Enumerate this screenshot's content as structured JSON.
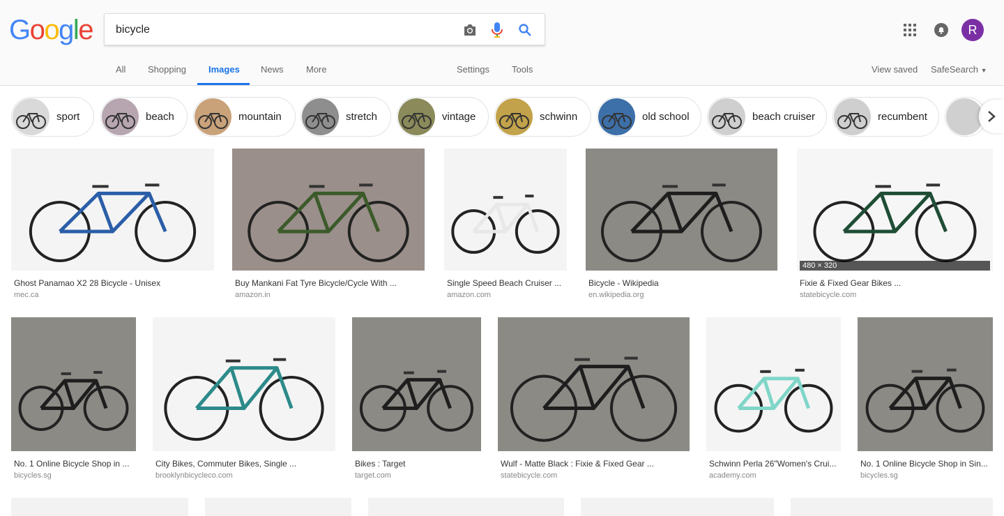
{
  "search": {
    "query": "bicycle"
  },
  "logo": {
    "text": "Google"
  },
  "tabs": [
    {
      "label": "All"
    },
    {
      "label": "Shopping"
    },
    {
      "label": "Images"
    },
    {
      "label": "News"
    },
    {
      "label": "More"
    },
    {
      "label": "Settings"
    },
    {
      "label": "Tools"
    }
  ],
  "header_right": {
    "view_saved": "View saved",
    "safesearch": "SafeSearch",
    "avatar_letter": "R"
  },
  "chips": [
    {
      "label": "sport"
    },
    {
      "label": "beach"
    },
    {
      "label": "mountain"
    },
    {
      "label": "stretch"
    },
    {
      "label": "vintage"
    },
    {
      "label": "schwinn"
    },
    {
      "label": "old school"
    },
    {
      "label": "beach cruiser"
    },
    {
      "label": "recumbent"
    }
  ],
  "results": [
    {
      "title": "Ghost Panamao X2 28 Bicycle - Unisex",
      "domain": "mec.ca",
      "frame": "blue"
    },
    {
      "title": "Buy Mankani Fat Tyre Bicycle/Cycle With ...",
      "domain": "amazon.in",
      "frame": "green"
    },
    {
      "title": "Single Speed Beach Cruiser ...",
      "domain": "amazon.com",
      "frame": "white"
    },
    {
      "title": "Bicycle - Wikipedia",
      "domain": "en.wikipedia.org",
      "frame": "black"
    },
    {
      "title": "Fixie & Fixed Gear Bikes ...",
      "domain": "statebicycle.com",
      "frame": "darkgreen",
      "dims": "480 × 320"
    },
    {
      "title": "No. 1 Online Bicycle Shop in ...",
      "domain": "bicycles.sg",
      "frame": "black"
    },
    {
      "title": "City Bikes, Commuter Bikes, Single ...",
      "domain": "brooklynbicycleco.com",
      "frame": "teal"
    },
    {
      "title": "Bikes : Target",
      "domain": "target.com",
      "frame": "black"
    },
    {
      "title": "Wulf - Matte Black : Fixie & Fixed Gear ...",
      "domain": "statebicycle.com",
      "frame": "black"
    },
    {
      "title": "Schwinn Perla 26\"Women's Crui...",
      "domain": "academy.com",
      "frame": "mint"
    },
    {
      "title": "No. 1 Online Bicycle Shop in Sin...",
      "domain": "bicycles.sg",
      "frame": "black"
    }
  ],
  "colors": {
    "accent": "#1a73e8",
    "avatar": "#7b2fa5"
  }
}
